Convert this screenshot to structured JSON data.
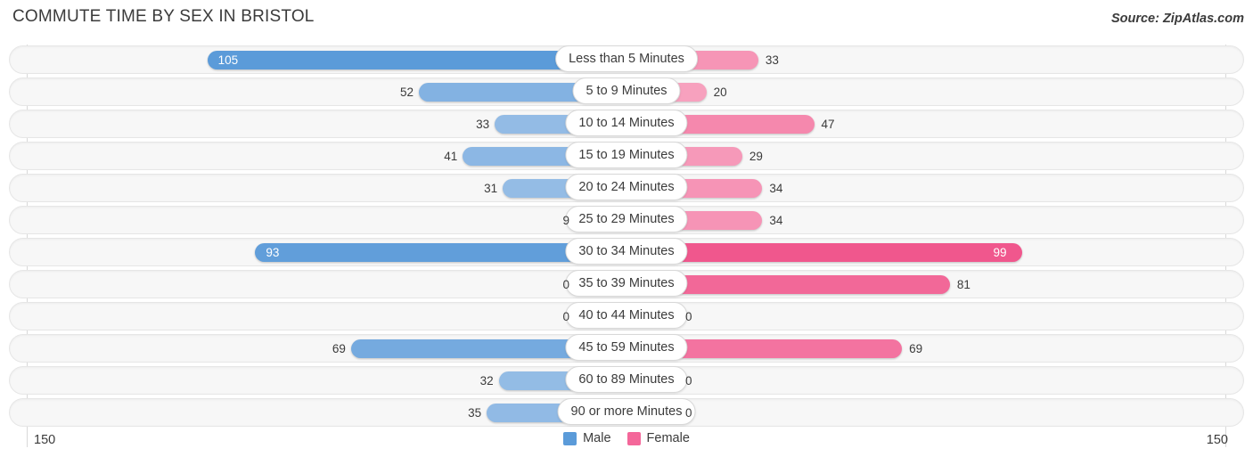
{
  "header": {
    "title": "COMMUTE TIME BY SEX IN BRISTOL",
    "source": "Source: ZipAtlas.com"
  },
  "legend": {
    "male_label": "Male",
    "female_label": "Female",
    "male_color": "#5b9bd9",
    "female_color": "#f4679a"
  },
  "axis": {
    "left_label": "150",
    "right_label": "150",
    "max": 150
  },
  "chart_data": {
    "type": "bar",
    "orientation": "horizontal-diverging",
    "title": "COMMUTE TIME BY SEX IN BRISTOL",
    "xlabel": "",
    "ylabel": "",
    "xlim": [
      -150,
      150
    ],
    "grid": false,
    "legend_position": "bottom-center",
    "categories": [
      "Less than 5 Minutes",
      "5 to 9 Minutes",
      "10 to 14 Minutes",
      "15 to 19 Minutes",
      "20 to 24 Minutes",
      "25 to 29 Minutes",
      "30 to 34 Minutes",
      "35 to 39 Minutes",
      "40 to 44 Minutes",
      "45 to 59 Minutes",
      "60 to 89 Minutes",
      "90 or more Minutes"
    ],
    "series": [
      {
        "name": "Male",
        "side": "left",
        "values": [
          105,
          52,
          33,
          41,
          31,
          9,
          93,
          0,
          0,
          69,
          32,
          35
        ]
      },
      {
        "name": "Female",
        "side": "right",
        "values": [
          33,
          20,
          47,
          29,
          34,
          34,
          99,
          81,
          0,
          69,
          0,
          0
        ]
      }
    ]
  },
  "rows": [
    {
      "category": "Less than 5 Minutes",
      "male": "105",
      "female": "33",
      "male_inside": true,
      "female_inside": false
    },
    {
      "category": "5 to 9 Minutes",
      "male": "52",
      "female": "20",
      "male_inside": false,
      "female_inside": false
    },
    {
      "category": "10 to 14 Minutes",
      "male": "33",
      "female": "47",
      "male_inside": false,
      "female_inside": false
    },
    {
      "category": "15 to 19 Minutes",
      "male": "41",
      "female": "29",
      "male_inside": false,
      "female_inside": false
    },
    {
      "category": "20 to 24 Minutes",
      "male": "31",
      "female": "34",
      "male_inside": false,
      "female_inside": false
    },
    {
      "category": "25 to 29 Minutes",
      "male": "9",
      "female": "34",
      "male_inside": false,
      "female_inside": false
    },
    {
      "category": "30 to 34 Minutes",
      "male": "93",
      "female": "99",
      "male_inside": true,
      "female_inside": true
    },
    {
      "category": "35 to 39 Minutes",
      "male": "0",
      "female": "81",
      "male_inside": false,
      "female_inside": false
    },
    {
      "category": "40 to 44 Minutes",
      "male": "0",
      "female": "0",
      "male_inside": false,
      "female_inside": false
    },
    {
      "category": "45 to 59 Minutes",
      "male": "69",
      "female": "69",
      "male_inside": false,
      "female_inside": false
    },
    {
      "category": "60 to 89 Minutes",
      "male": "32",
      "female": "0",
      "male_inside": false,
      "female_inside": false
    },
    {
      "category": "90 or more Minutes",
      "male": "35",
      "female": "0",
      "male_inside": false,
      "female_inside": false
    }
  ]
}
